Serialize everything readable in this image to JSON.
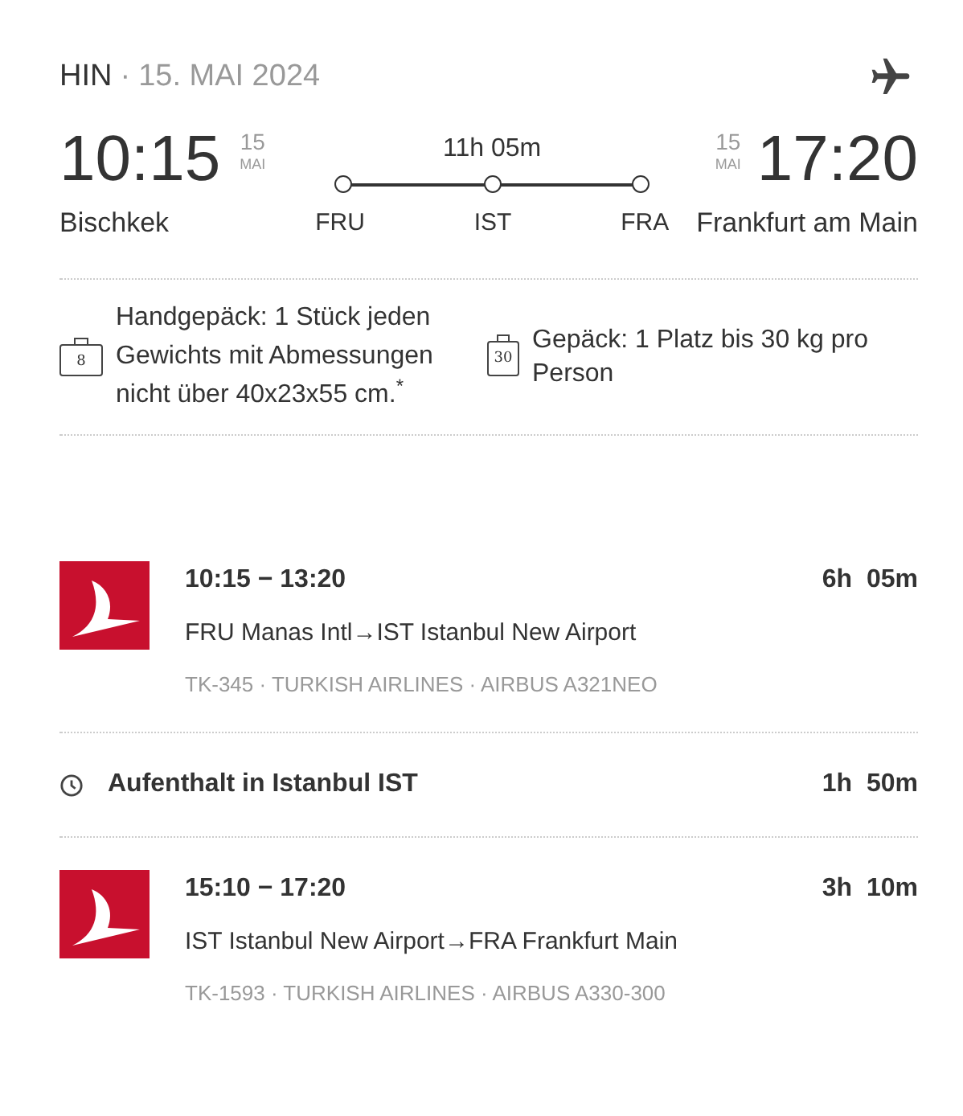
{
  "header": {
    "direction": "HIN",
    "separator": "·",
    "date": "15. MAI 2024"
  },
  "departure": {
    "time": "10:15",
    "day": "15",
    "month": "MAI",
    "city": "Bischkek"
  },
  "route": {
    "duration": "11h 05m",
    "stops": [
      "FRU",
      "IST",
      "FRA"
    ]
  },
  "arrival": {
    "time": "17:20",
    "day": "15",
    "month": "MAI",
    "city": "Frankfurt am Main"
  },
  "baggage": [
    {
      "kind": "hand",
      "badge": "8",
      "text": "Handgepäck: 1 Stück jeden Gewichts mit Abmessungen nicht über 40x23x55 cm.$^{*}$"
    },
    {
      "kind": "checked",
      "badge": "30",
      "text": "Gepäck: 1 Platz bis 30 kg pro Person"
    }
  ],
  "itinerary": [
    {
      "kind": "segment",
      "times": "10:15 − 13:20",
      "duration": "6h  05m",
      "route": "FRU Manas Intl→IST Istanbul New Airport",
      "details": "TK-345 · TURKISH AIRLINES · AIRBUS A321NEO"
    },
    {
      "kind": "layover",
      "text": "Aufenthalt in Istanbul IST",
      "duration": "1h  50m"
    },
    {
      "kind": "segment",
      "times": "15:10 − 17:20",
      "duration": "3h  10m",
      "route": "IST Istanbul New Airport→FRA Frankfurt Main",
      "details": "TK-1593 · TURKISH AIRLINES · AIRBUS A330-300"
    }
  ]
}
